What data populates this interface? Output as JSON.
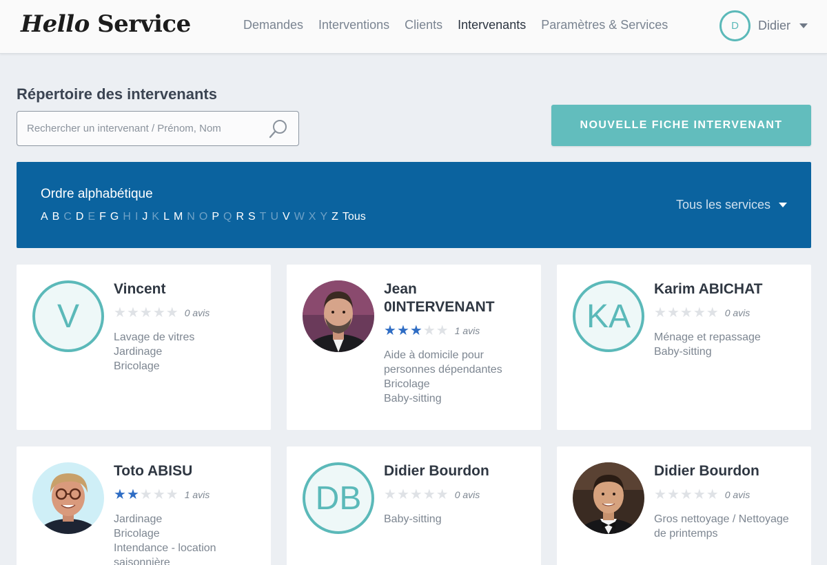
{
  "header": {
    "logo_part1": "Hello",
    "logo_part2": "Service",
    "nav": [
      {
        "label": "Demandes"
      },
      {
        "label": "Interventions"
      },
      {
        "label": "Clients"
      },
      {
        "label": "Intervenants",
        "active": true
      },
      {
        "label": "Paramètres & Services"
      }
    ],
    "user": {
      "initial": "D",
      "name": "Didier"
    }
  },
  "page": {
    "title": "Répertoire des intervenants",
    "search_placeholder": "Rechercher un intervenant / Prénom, Nom",
    "new_button": "NOUVELLE FICHE INTERVENANT"
  },
  "filter": {
    "title": "Ordre alphabétique",
    "letters": [
      {
        "l": "A",
        "on": true
      },
      {
        "l": "B",
        "on": true
      },
      {
        "l": "C",
        "on": false
      },
      {
        "l": "D",
        "on": true
      },
      {
        "l": "E",
        "on": false
      },
      {
        "l": "F",
        "on": true
      },
      {
        "l": "G",
        "on": true
      },
      {
        "l": "H",
        "on": false
      },
      {
        "l": "I",
        "on": false
      },
      {
        "l": "J",
        "on": true
      },
      {
        "l": "K",
        "on": false
      },
      {
        "l": "L",
        "on": true
      },
      {
        "l": "M",
        "on": true
      },
      {
        "l": "N",
        "on": false
      },
      {
        "l": "O",
        "on": false
      },
      {
        "l": "P",
        "on": true
      },
      {
        "l": "Q",
        "on": false
      },
      {
        "l": "R",
        "on": true
      },
      {
        "l": "S",
        "on": true
      },
      {
        "l": "T",
        "on": false
      },
      {
        "l": "U",
        "on": false
      },
      {
        "l": "V",
        "on": true
      },
      {
        "l": "W",
        "on": false
      },
      {
        "l": "X",
        "on": false
      },
      {
        "l": "Y",
        "on": false
      },
      {
        "l": "Z",
        "on": true
      },
      {
        "l": "Tous",
        "on": true
      }
    ],
    "service_select": "Tous les services"
  },
  "cards": [
    {
      "name": "Vincent",
      "initials": "V",
      "photo": false,
      "stars": 0,
      "reviews": "0 avis",
      "services": [
        "Lavage de vitres",
        "Jardinage",
        "Bricolage"
      ]
    },
    {
      "name": "Jean 0INTERVENANT",
      "initials": "",
      "photo": true,
      "photo_icon": "man-beard-portrait",
      "stars": 3,
      "reviews": "1 avis",
      "services": [
        "Aide à domicile pour personnes dépendantes",
        "Bricolage",
        "Baby-sitting"
      ]
    },
    {
      "name": "Karim ABICHAT",
      "initials": "KA",
      "photo": false,
      "stars": 0,
      "reviews": "0 avis",
      "services": [
        "Ménage et repassage",
        "Baby-sitting"
      ]
    },
    {
      "name": "Toto ABISU",
      "initials": "",
      "photo": true,
      "photo_icon": "man-glasses-portrait",
      "stars": 2,
      "reviews": "1 avis",
      "services": [
        "Jardinage",
        "Bricolage",
        "Intendance - location saisonnière"
      ]
    },
    {
      "name": "Didier Bourdon",
      "initials": "DB",
      "photo": false,
      "stars": 0,
      "reviews": "0 avis",
      "services": [
        "Baby-sitting"
      ]
    },
    {
      "name": "Didier Bourdon",
      "initials": "",
      "photo": true,
      "photo_icon": "man-bowtie-portrait",
      "stars": 0,
      "reviews": "0 avis",
      "services": [
        "Gros nettoyage / Nettoyage de printemps"
      ]
    }
  ],
  "colors": {
    "accent": "#62bdbd",
    "filter_bg": "#0b639f",
    "star_on": "#2f6dc4",
    "star_off": "#dfe2e6"
  }
}
